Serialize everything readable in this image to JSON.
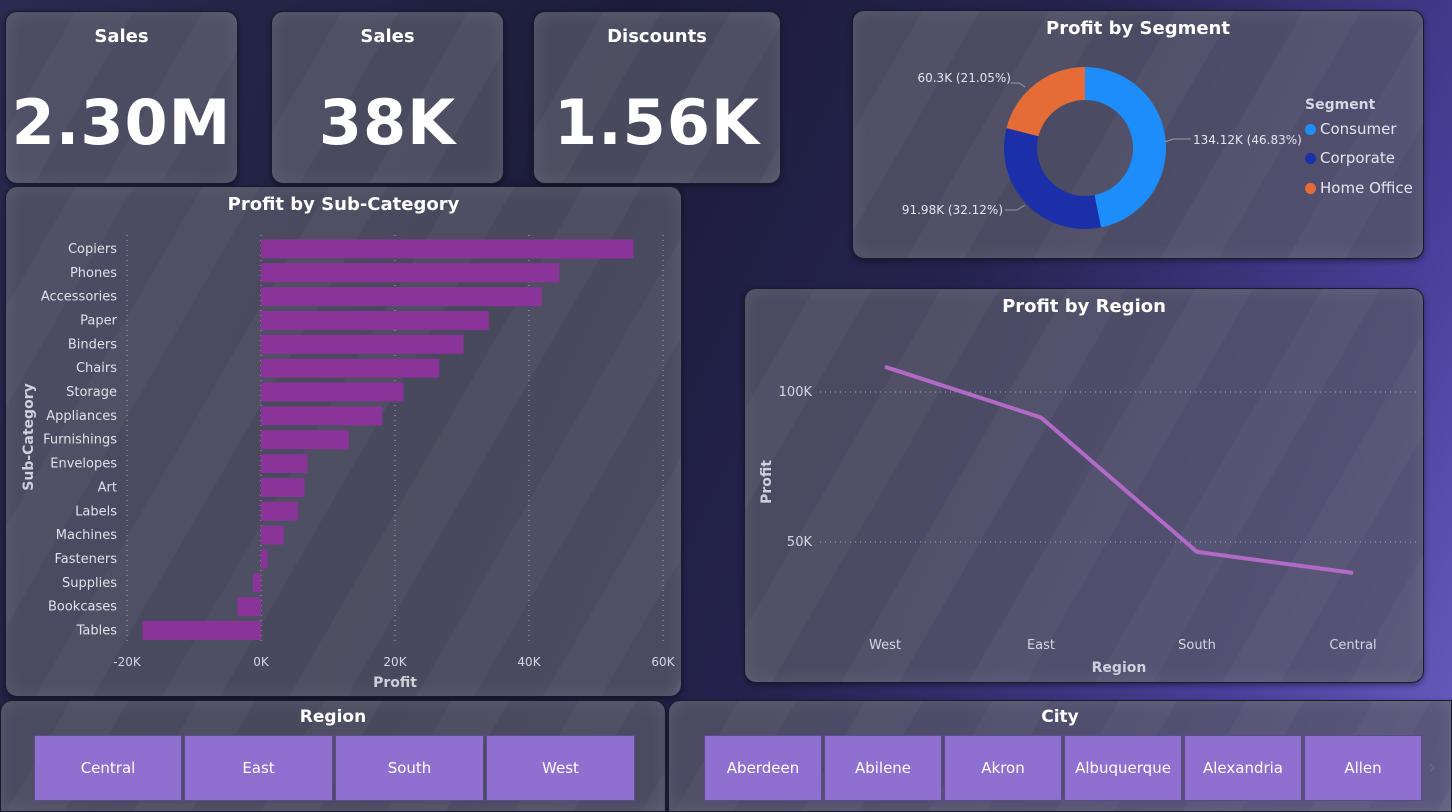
{
  "kpis": [
    {
      "title": "Sales",
      "value": "2.30M"
    },
    {
      "title": "Sales",
      "value": "38K"
    },
    {
      "title": "Discounts",
      "value": "1.56K"
    }
  ],
  "segment_chart": {
    "title": "Profit by Segment",
    "legend_title": "Segment",
    "labels": {
      "consumer": "134.12K (46.83%)",
      "corporate": "91.98K (32.12%)",
      "home_office": "60.3K (21.05%)"
    },
    "legend": [
      "Consumer",
      "Corporate",
      "Home Office"
    ]
  },
  "subcategory_chart": {
    "title": "Profit by Sub-Category",
    "xlabel": "Profit",
    "ylabel": "Sub-Category",
    "ticks": [
      "-20K",
      "0K",
      "20K",
      "40K",
      "60K"
    ]
  },
  "region_chart": {
    "title": "Profit by Region",
    "xlabel": "Region",
    "ylabel": "Profit",
    "yticks": [
      "100K",
      "50K"
    ]
  },
  "region_slicer": {
    "title": "Region",
    "options": [
      "Central",
      "East",
      "South",
      "West"
    ]
  },
  "city_slicer": {
    "title": "City",
    "options": [
      "Aberdeen",
      "Abilene",
      "Akron",
      "Albuquerque",
      "Alexandria",
      "Allen"
    ]
  },
  "colors": {
    "bar": "#8a3499",
    "line": "#b36ac7",
    "consumer": "#1c8dfa",
    "corporate": "#1b2fa8",
    "home_office": "#e66c37"
  },
  "chart_data": [
    {
      "type": "bar",
      "orientation": "horizontal",
      "title": "Profit by Sub-Category",
      "xlabel": "Profit",
      "ylabel": "Sub-Category",
      "xlim": [
        -20000,
        60000
      ],
      "categories": [
        "Copiers",
        "Phones",
        "Accessories",
        "Paper",
        "Binders",
        "Chairs",
        "Storage",
        "Appliances",
        "Furnishings",
        "Envelopes",
        "Art",
        "Labels",
        "Machines",
        "Fasteners",
        "Supplies",
        "Bookcases",
        "Tables"
      ],
      "values": [
        55600,
        44500,
        41900,
        34000,
        30200,
        26600,
        21300,
        18100,
        13100,
        6900,
        6500,
        5500,
        3400,
        950,
        -1200,
        -3500,
        -17700
      ]
    },
    {
      "type": "line",
      "title": "Profit by Region",
      "xlabel": "Region",
      "ylabel": "Profit",
      "categories": [
        "West",
        "East",
        "South",
        "Central"
      ],
      "values": [
        108400,
        91500,
        46700,
        39700
      ],
      "yticks": [
        50000,
        100000
      ]
    },
    {
      "type": "pie",
      "title": "Profit by Segment",
      "categories": [
        "Consumer",
        "Corporate",
        "Home Office"
      ],
      "values": [
        134120,
        91980,
        60300
      ],
      "percent": [
        46.83,
        32.12,
        21.05
      ]
    }
  ]
}
